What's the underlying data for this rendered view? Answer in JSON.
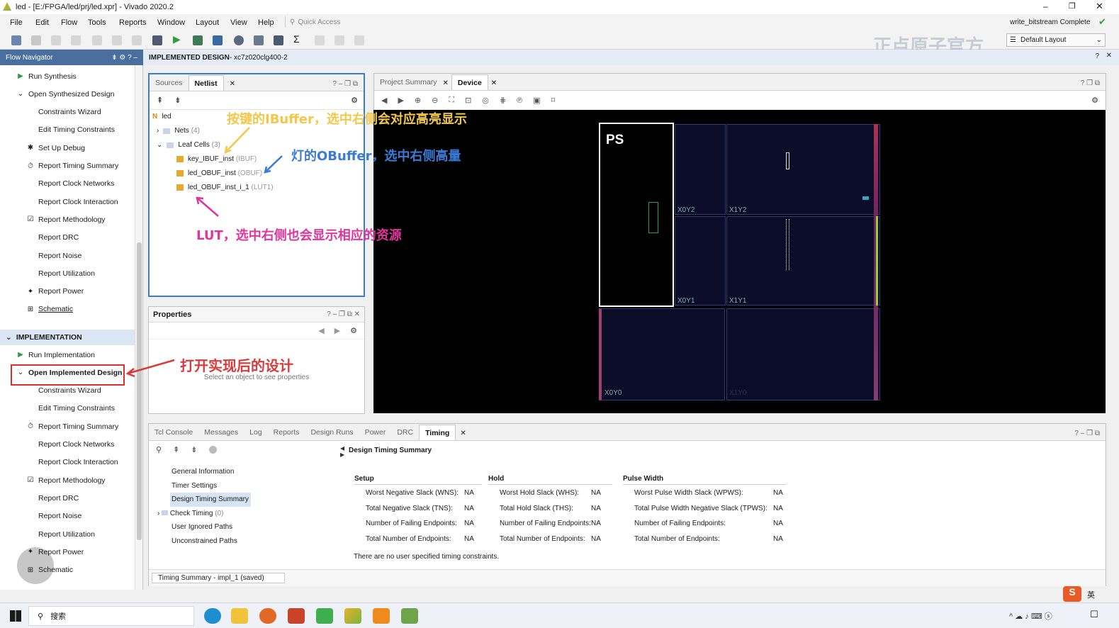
{
  "window": {
    "title": "led - [E:/FPGA/led/prj/led.xpr] - Vivado 2020.2",
    "status": "write_bitstream Complete",
    "layout": "Default Layout"
  },
  "menu": [
    "File",
    "Edit",
    "Flow",
    "Tools",
    "Reports",
    "Window",
    "Layout",
    "View",
    "Help"
  ],
  "quick_access": "Quick Access",
  "watermark": "正点原子官方",
  "flow_nav": {
    "title": "Flow Navigator",
    "items": [
      {
        "label": "Run Synthesis",
        "icon": "play-icon",
        "indent": 1
      },
      {
        "label": "Open Synthesized Design",
        "icon": "chevron-down-icon",
        "indent": 1
      },
      {
        "label": "Constraints Wizard",
        "icon": "",
        "indent": 2
      },
      {
        "label": "Edit Timing Constraints",
        "icon": "",
        "indent": 2
      },
      {
        "label": "Set Up Debug",
        "icon": "bug-icon",
        "indent": 2
      },
      {
        "label": "Report Timing Summary",
        "icon": "clock-icon",
        "indent": 2
      },
      {
        "label": "Report Clock Networks",
        "icon": "",
        "indent": 2
      },
      {
        "label": "Report Clock Interaction",
        "icon": "",
        "indent": 2
      },
      {
        "label": "Report Methodology",
        "icon": "checklist-icon",
        "indent": 2
      },
      {
        "label": "Report DRC",
        "icon": "",
        "indent": 2
      },
      {
        "label": "Report Noise",
        "icon": "",
        "indent": 2
      },
      {
        "label": "Report Utilization",
        "icon": "",
        "indent": 2
      },
      {
        "label": "Report Power",
        "icon": "power-icon",
        "indent": 2
      },
      {
        "label": "Schematic",
        "icon": "schematic-icon",
        "indent": 2
      }
    ],
    "impl_header": "IMPLEMENTATION",
    "impl_items": [
      {
        "label": "Run Implementation",
        "icon": "play-icon",
        "indent": 1
      },
      {
        "label": "Open Implemented Design",
        "icon": "chevron-down-icon",
        "indent": 1
      },
      {
        "label": "Constraints Wizard",
        "icon": "",
        "indent": 2
      },
      {
        "label": "Edit Timing Constraints",
        "icon": "",
        "indent": 2
      },
      {
        "label": "Report Timing Summary",
        "icon": "clock-icon",
        "indent": 2
      },
      {
        "label": "Report Clock Networks",
        "icon": "",
        "indent": 2
      },
      {
        "label": "Report Clock Interaction",
        "icon": "",
        "indent": 2
      },
      {
        "label": "Report Methodology",
        "icon": "checklist-icon",
        "indent": 2
      },
      {
        "label": "Report DRC",
        "icon": "",
        "indent": 2
      },
      {
        "label": "Report Noise",
        "icon": "",
        "indent": 2
      },
      {
        "label": "Report Utilization",
        "icon": "",
        "indent": 2
      },
      {
        "label": "Report Power",
        "icon": "power-icon",
        "indent": 2
      },
      {
        "label": "Schematic",
        "icon": "schematic-icon",
        "indent": 2
      }
    ]
  },
  "design_bar": {
    "label": "IMPLEMENTED DESIGN",
    "part": " - xc7z020clg400-2"
  },
  "netlist": {
    "tabs": [
      "Sources",
      "Netlist"
    ],
    "top": "led",
    "nets": "Nets",
    "nets_count": "(4)",
    "leaf": "Leaf Cells",
    "leaf_count": "(3)",
    "cells": [
      {
        "name": "key_IBUF_inst",
        "type": "(IBUF)"
      },
      {
        "name": "led_OBUF_inst",
        "type": "(OBUF)"
      },
      {
        "name": "led_OBUF_inst_i_1",
        "type": "(LUT1)"
      }
    ]
  },
  "properties": {
    "title": "Properties",
    "empty": "Select an object to see properties"
  },
  "device": {
    "tabs": [
      "Project Summary",
      "Device"
    ],
    "ps": "PS",
    "regions": [
      "X0Y2",
      "X1Y2",
      "X0Y1",
      "X1Y1",
      "X0Y0",
      "X1Y0"
    ]
  },
  "annotations": {
    "ibuf": "按键的IBuffer，选中右侧会对应高亮显示",
    "obuf": "灯的OBuffer，选中右侧高量",
    "lut": "LUT，选中右侧也会显示相应的资源",
    "open": "打开实现后的设计"
  },
  "bottom": {
    "tabs": [
      "Tcl Console",
      "Messages",
      "Log",
      "Reports",
      "Design Runs",
      "Power",
      "DRC",
      "Timing"
    ],
    "tree": [
      "General Information",
      "Timer Settings",
      "Design Timing Summary",
      "Check Timing",
      "User Ignored Paths",
      "Unconstrained Paths"
    ],
    "check_count": "(0)",
    "summary_title": "Design Timing Summary",
    "setup": {
      "title": "Setup",
      "rows": [
        [
          "Worst Negative Slack (WNS):",
          "NA"
        ],
        [
          "Total Negative Slack (TNS):",
          "NA"
        ],
        [
          "Number of Failing Endpoints:",
          "NA"
        ],
        [
          "Total Number of Endpoints:",
          "NA"
        ]
      ]
    },
    "hold": {
      "title": "Hold",
      "rows": [
        [
          "Worst Hold Slack (WHS):",
          "NA"
        ],
        [
          "Total Hold Slack (THS):",
          "NA"
        ],
        [
          "Number of Failing Endpoints:",
          "NA"
        ],
        [
          "Total Number of Endpoints:",
          "NA"
        ]
      ]
    },
    "pulse": {
      "title": "Pulse Width",
      "rows": [
        [
          "Worst Pulse Width Slack (WPWS):",
          "NA"
        ],
        [
          "Total Pulse Width Negative Slack (TPWS):",
          "NA"
        ],
        [
          "Number of Failing Endpoints:",
          "NA"
        ],
        [
          "Total Number of Endpoints:",
          "NA"
        ]
      ]
    },
    "note": "There are no user specified timing constraints.",
    "footer_tab": "Timing Summary - impl_1 (saved)"
  },
  "taskbar": {
    "search": "搜索",
    "ime": "英"
  },
  "colors": {
    "accent": "#4a6f9e",
    "ibuf_anno": "#f2c84b",
    "obuf_anno": "#3a7bd5",
    "lut_anno": "#e0359c",
    "open_anno": "#d93a3a"
  }
}
